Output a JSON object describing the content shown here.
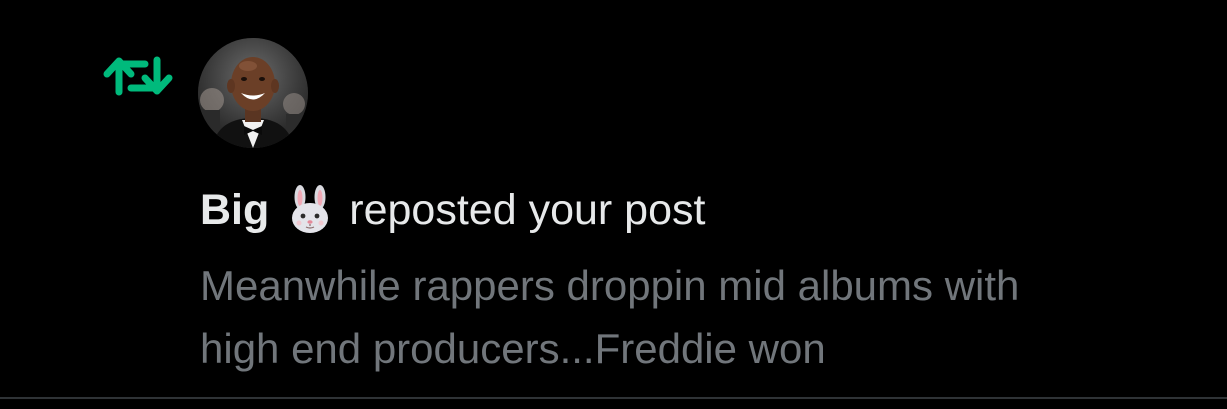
{
  "notification": {
    "user_name": "Big",
    "user_emoji": "rabbit-face",
    "action": "reposted your post",
    "post_text": "Meanwhile rappers droppin mid albums with\nhigh end producers...Freddie won",
    "icon": "repost-icon",
    "accent_color": "#00ba7c",
    "text_color": "#e7e9ea",
    "muted_text_color": "#71767b",
    "background_color": "#000000"
  }
}
